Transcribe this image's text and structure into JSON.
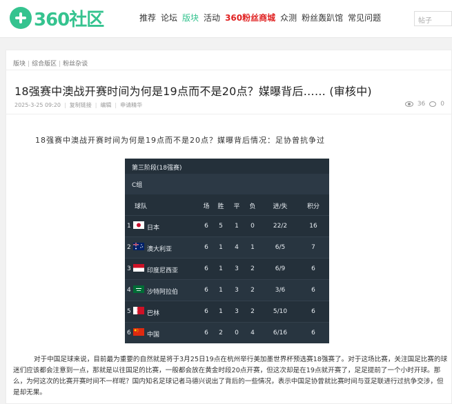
{
  "header": {
    "logo_text": "360社区",
    "nav": [
      {
        "label": "推荐",
        "style": "normal"
      },
      {
        "label": "论坛",
        "style": "normal"
      },
      {
        "label": "版块",
        "style": "active"
      },
      {
        "label": "活动",
        "style": "normal"
      },
      {
        "label": "360粉丝商城",
        "style": "red"
      },
      {
        "label": "众测",
        "style": "normal"
      },
      {
        "label": "粉丝轰趴馆",
        "style": "normal"
      },
      {
        "label": "常见问题",
        "style": "normal"
      }
    ],
    "search_placeholder": "帖子"
  },
  "breadcrumb": [
    "版块",
    "综合版区",
    "粉丝杂谈"
  ],
  "post": {
    "title": "18强赛中澳战开赛时间为何是19点而不是20点？媒曝背后…… (审核中)",
    "date": "2025-3-25 09:20",
    "actions": [
      "复制链接",
      "编辑",
      "申请精华"
    ],
    "views": "36",
    "comments": "0",
    "lead": "18强赛中澳战开赛时间为何是19点而不是20点？媒曝背后情况：足协曾抗争过",
    "body": "对于中国足球来说，目前最为重要的自然就是将于3月25日19点在杭州举行美加墨世界杯预选赛18强赛了。对于这场比赛，关注国足比赛的球迷们应该都会注意到一点，那就是以往国足的比赛，一般都会放在黄金时段20点开赛，但这次却是在19点就开赛了，足足提前了一个小时开球。那么，为何这次的比赛开赛时间不一样呢？国内知名足球记者马德兴说出了背后的一些情况，表示中国足协曾就比赛时间与亚足联进行过抗争交涉，但是却无果。"
  },
  "standings": {
    "stage": "第三阶段(18强赛)",
    "group": "C组",
    "columns": [
      "球队",
      "场",
      "胜",
      "平",
      "负",
      "进/失",
      "积分"
    ],
    "rows": [
      {
        "rank": "1",
        "team": "日本",
        "flag": "japan-flag",
        "p": "6",
        "w": "5",
        "d": "1",
        "l": "0",
        "gd": "22/2",
        "pts": "16"
      },
      {
        "rank": "2",
        "team": "澳大利亚",
        "flag": "australia-flag",
        "p": "6",
        "w": "1",
        "d": "4",
        "l": "1",
        "gd": "6/5",
        "pts": "7"
      },
      {
        "rank": "3",
        "team": "印度尼西亚",
        "flag": "indonesia-flag",
        "p": "6",
        "w": "1",
        "d": "3",
        "l": "2",
        "gd": "6/9",
        "pts": "6"
      },
      {
        "rank": "4",
        "team": "沙特阿拉伯",
        "flag": "saudi-flag",
        "p": "6",
        "w": "1",
        "d": "3",
        "l": "2",
        "gd": "3/6",
        "pts": "6"
      },
      {
        "rank": "5",
        "team": "巴林",
        "flag": "bahrain-flag",
        "p": "6",
        "w": "1",
        "d": "3",
        "l": "2",
        "gd": "5/10",
        "pts": "6"
      },
      {
        "rank": "6",
        "team": "中国",
        "flag": "china-flag",
        "p": "6",
        "w": "2",
        "d": "0",
        "l": "4",
        "gd": "6/16",
        "pts": "6"
      }
    ]
  },
  "colors": {
    "brand": "#35c38f",
    "mall": "#e02020"
  }
}
